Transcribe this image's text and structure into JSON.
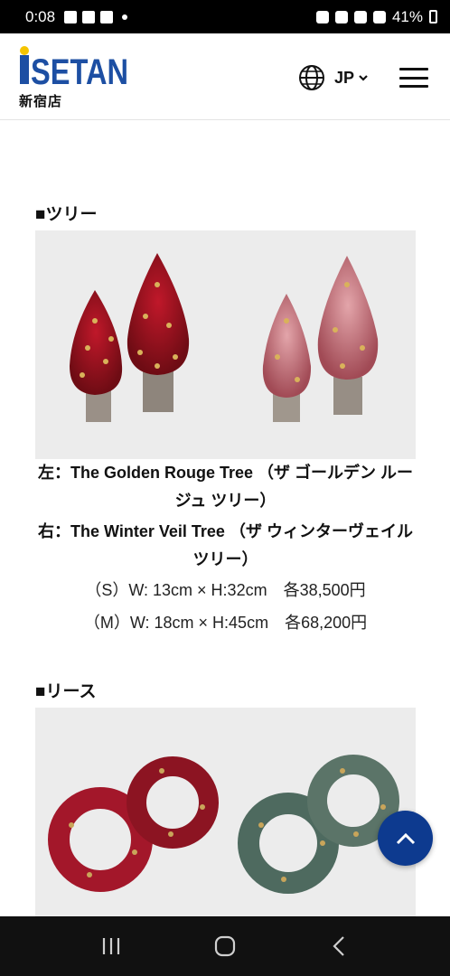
{
  "status_bar": {
    "time": "0:08",
    "battery_percent": "41%"
  },
  "header": {
    "store_name": "新宿店",
    "language": "JP",
    "logo_icon": "isetan-logo"
  },
  "content": {
    "tree_section": {
      "heading": "■ツリー",
      "caption_left": "左：The Golden Rouge Tree （ザ ゴールデン ルージュ ツリー）",
      "caption_right": "右：The Winter Veil Tree （ザ ウィンターヴェイル ツリー）",
      "size_small": "（S）W: 13cm × H:32cm　各38,500円",
      "size_medium": "（M）W: 18cm × H:45cm　各68,200円"
    },
    "wreath_section": {
      "heading": "■リース"
    }
  },
  "colors": {
    "accent_blue": "#0d3a8f",
    "logo_blue": "#1d4fa3",
    "logo_yellow": "#f5c400"
  }
}
